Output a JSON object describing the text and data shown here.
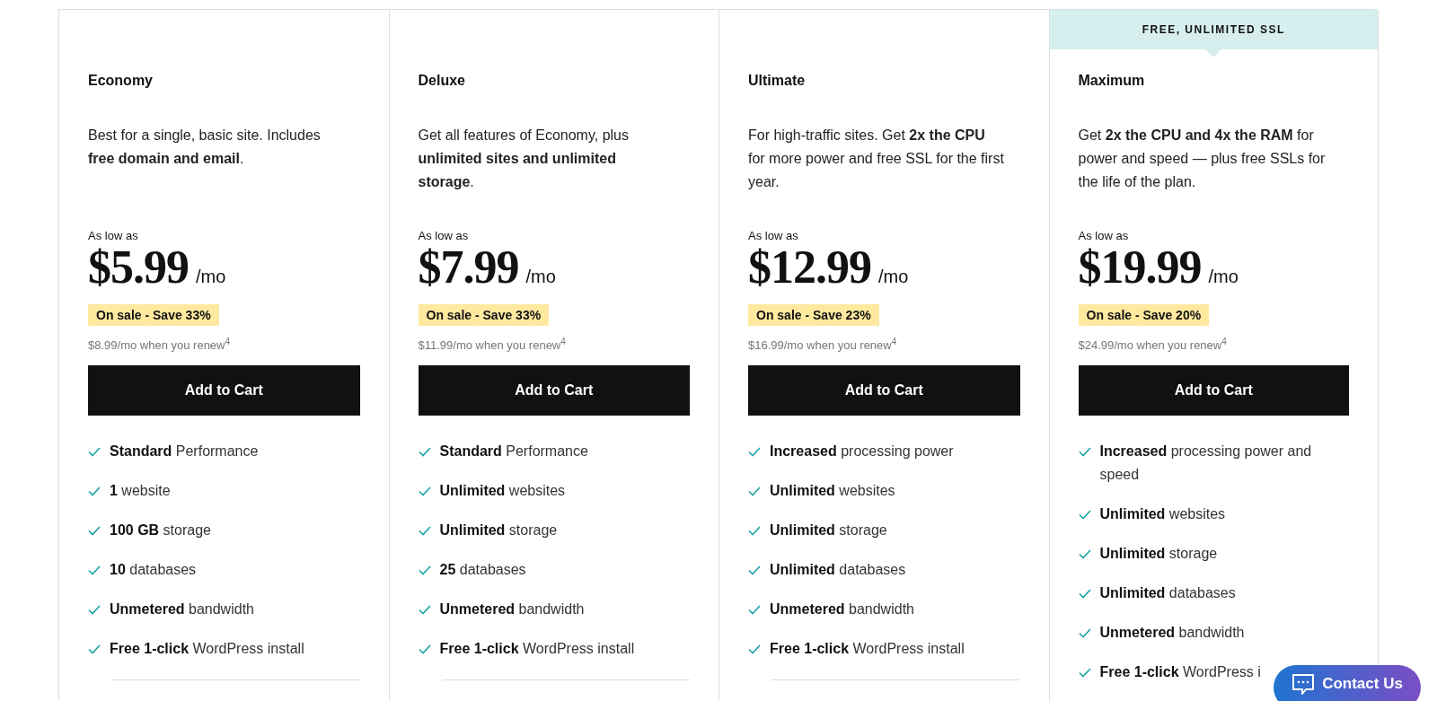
{
  "plans": [
    {
      "name": "Economy",
      "description": "Best for a single, basic site. Includes **free domain and email**.",
      "price_label": "As low as",
      "price": "$5.99",
      "period": "/mo",
      "sale": "On sale - Save 33%",
      "renew": "$8.99/mo when you renew$^{4}$",
      "button": "Add to Cart",
      "features": [
        "**Standard** Performance",
        "**1** website",
        "**100 GB** storage",
        "**10** databases",
        "**Unmetered** bandwidth",
        "**Free 1-click** WordPress install"
      ]
    },
    {
      "name": "Deluxe",
      "description": "Get all features of Economy, plus **unlimited sites and unlimited storage**.",
      "price_label": "As low as",
      "price": "$7.99",
      "period": "/mo",
      "sale": "On sale - Save 33%",
      "renew": "$11.99/mo when you renew$^{4}$",
      "button": "Add to Cart",
      "features": [
        "**Standard** Performance",
        "**Unlimited** websites",
        "**Unlimited** storage",
        "**25** databases",
        "**Unmetered** bandwidth",
        "**Free 1-click** WordPress install"
      ]
    },
    {
      "name": "Ultimate",
      "description": "For high-traffic sites. Get **2x the CPU** for more power and free SSL for the first year.",
      "price_label": "As low as",
      "price": "$12.99",
      "period": "/mo",
      "sale": "On sale - Save 23%",
      "renew": "$16.99/mo when you renew$^{4}$",
      "button": "Add to Cart",
      "features": [
        "**Increased** processing power",
        "**Unlimited** websites",
        "**Unlimited** storage",
        "**Unlimited** databases",
        "**Unmetered** bandwidth",
        "**Free 1-click** WordPress install"
      ]
    },
    {
      "ribbon": "FREE, UNLIMITED SSL",
      "name": "Maximum",
      "description": "Get **2x the CPU and 4x the RAM** for power and speed — plus free SSLs for the life of the plan.",
      "price_label": "As low as",
      "price": "$19.99",
      "period": "/mo",
      "sale": "On sale - Save 20%",
      "renew": "$24.99/mo when you renew$^{4}$",
      "button": "Add to Cart",
      "features": [
        "**Increased** processing power and speed",
        "**Unlimited** websites",
        "**Unlimited** storage",
        "**Unlimited** databases",
        "**Unmetered** bandwidth",
        "**Free 1-click** WordPress i"
      ]
    }
  ],
  "contact_button": {
    "label": "Contact Us"
  }
}
